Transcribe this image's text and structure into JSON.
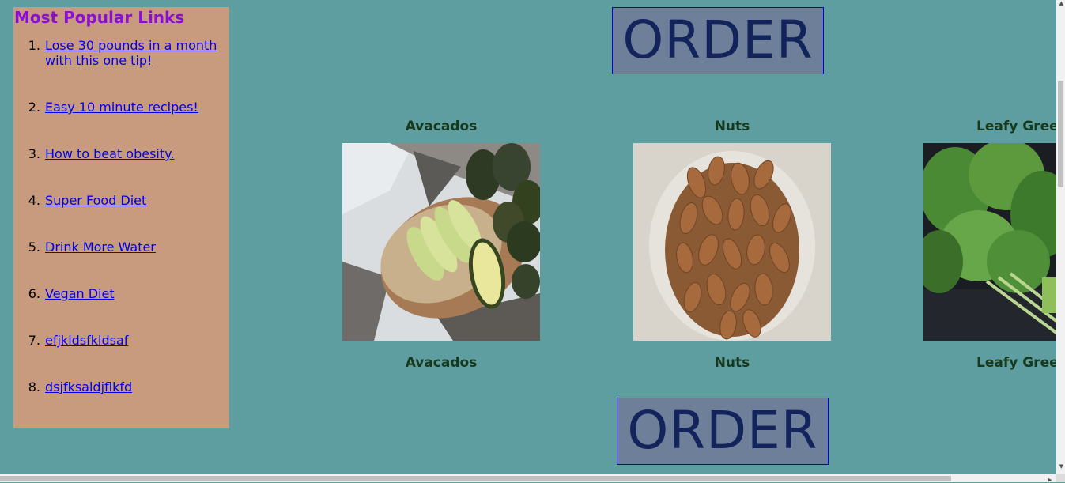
{
  "sidebar": {
    "title": "Most Popular Links",
    "links": [
      {
        "num": "1.",
        "label": "Lose 30 pounds in a month with this one tip!"
      },
      {
        "num": "2.",
        "label": "Easy 10 minute recipes!"
      },
      {
        "num": "3.",
        "label": "How to beat obesity."
      },
      {
        "num": "4.",
        "label": "Super Food Diet"
      },
      {
        "num": "5.",
        "label": "Drink More Water"
      },
      {
        "num": "6.",
        "label": "Vegan Diet"
      },
      {
        "num": "7.",
        "label": "efjkldsfkldsaf"
      },
      {
        "num": "8.",
        "label": "dsjfksaldjflkfd"
      }
    ]
  },
  "order_top": "ORDER",
  "order_bottom": "ORDER",
  "foods": [
    {
      "name": "Avacados"
    },
    {
      "name": "Nuts"
    },
    {
      "name": "Leafy Greens"
    }
  ],
  "scroll": {
    "up_icon": "▲",
    "down_icon": "▼",
    "right_icon": "▶"
  },
  "colors": {
    "background": "#5f9ea0",
    "sidebar": "#c89a7e",
    "title": "#8a0fcf",
    "order_bg": "#6e8099",
    "order_text": "#13235b"
  }
}
